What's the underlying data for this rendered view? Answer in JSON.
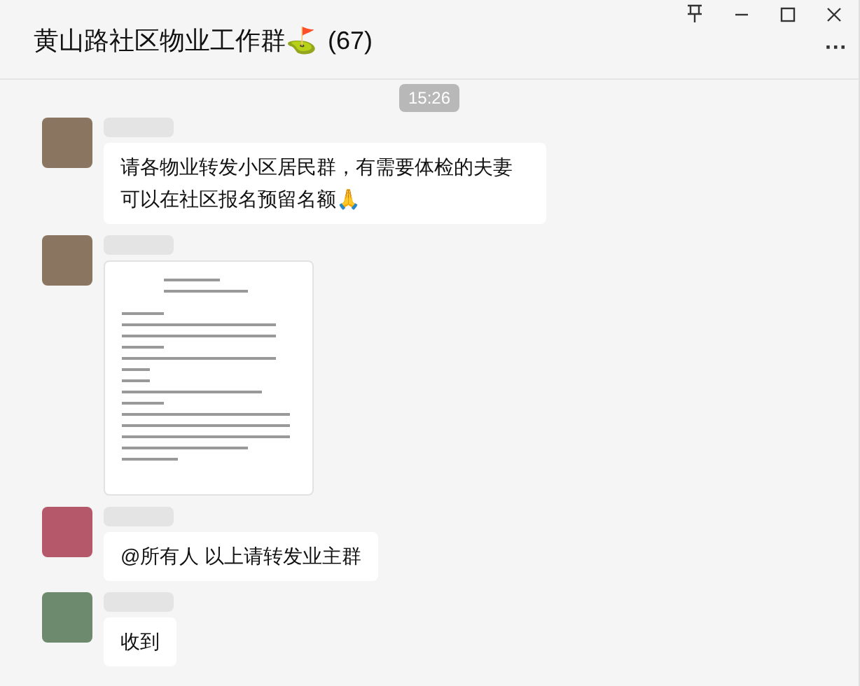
{
  "window": {
    "title": "黄山路社区物业工作群⛳",
    "member_count": "(67)",
    "more_label": "···"
  },
  "timestamp": "15:26",
  "messages": [
    {
      "kind": "text",
      "text": "请各物业转发小区居民群，有需要体检的夫妻可以在社区报名预留名额🙏"
    },
    {
      "kind": "image"
    },
    {
      "kind": "text",
      "text": "@所有人 以上请转发业主群"
    },
    {
      "kind": "text",
      "text": "收到"
    }
  ]
}
